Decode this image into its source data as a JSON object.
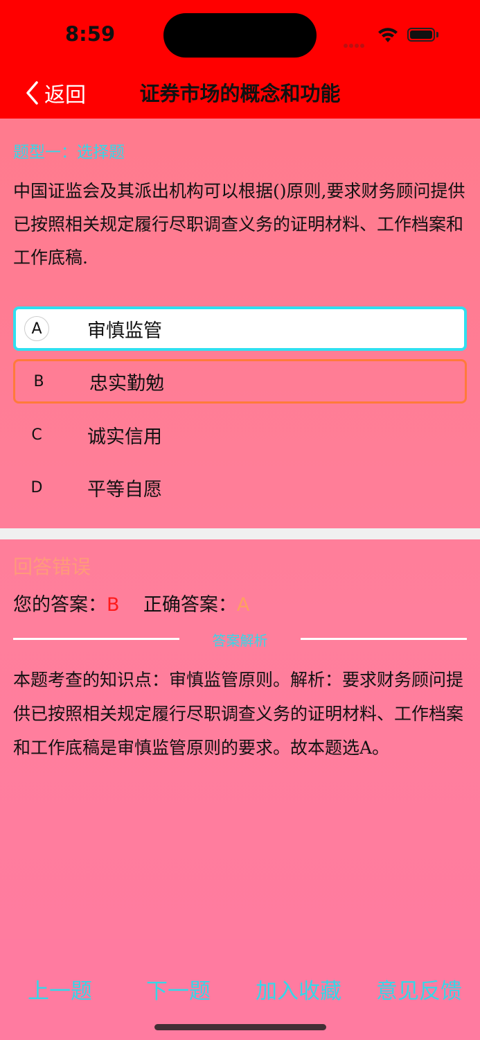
{
  "status": {
    "time": "8:59"
  },
  "nav": {
    "back_label": "返回",
    "title": "证券市场的概念和功能"
  },
  "question": {
    "type_label": "题型一：选择题",
    "text": "中国证监会及其派出机构可以根据()原则,要求财务顾问提供已按照相关规定履行尽职调查义务的证明材料、工作档案和工作底稿."
  },
  "options": [
    {
      "letter": "A",
      "text": "审慎监管"
    },
    {
      "letter": "B",
      "text": "忠实勤勉"
    },
    {
      "letter": "C",
      "text": "诚实信用"
    },
    {
      "letter": "D",
      "text": "平等自愿"
    }
  ],
  "result": {
    "status": "回答错误",
    "your_label": "您的答案：",
    "your_answer": "B",
    "correct_label": "正确答案：",
    "correct_answer": "A"
  },
  "analysis": {
    "label": "答案解析",
    "text": "本题考查的知识点：审慎监管原则。解析：要求财务顾问提供已按照相关规定履行尽职调查义务的证明材料、工作档案和工作底稿是审慎监管原则的要求。故本题选A。"
  },
  "toolbar": {
    "prev": "上一题",
    "next": "下一题",
    "favorite": "加入收藏",
    "feedback": "意见反馈"
  },
  "colors": {
    "nav_bg": "#ff0000",
    "accent": "#34d7e8",
    "wrong": "#ff1a1a",
    "correct": "#ffa060"
  }
}
